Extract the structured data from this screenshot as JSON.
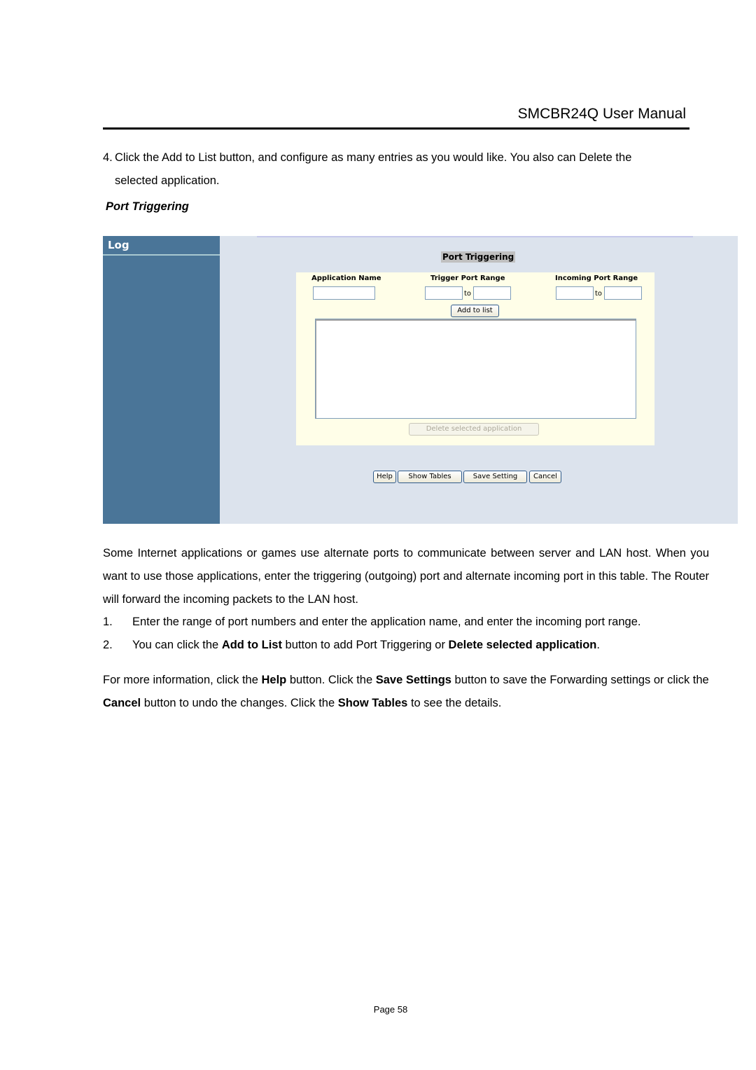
{
  "header": {
    "title": "SMCBR24Q User Manual"
  },
  "step4": {
    "number": "4.",
    "line1": "Click the Add to List button, and configure as many entries as you would like. You also can Delete the",
    "line2": "selected application."
  },
  "section_heading": "Port Triggering",
  "screenshot": {
    "sidebar": {
      "title": "Log"
    },
    "panel_title": "Port Triggering",
    "columns": {
      "application_name": "Application Name",
      "trigger_port_range": "Trigger Port Range",
      "incoming_port_range": "Incoming Port Range"
    },
    "fields": {
      "application_name": "",
      "trigger_from": "",
      "trigger_to": "",
      "incoming_from": "",
      "incoming_to": ""
    },
    "to_label": "to",
    "add_button": "Add to list",
    "application_list": [],
    "delete_button": "Delete selected application",
    "bottom_buttons": {
      "help": "Help",
      "show_tables": "Show Tables",
      "save_setting": "Save Setting",
      "cancel": "Cancel"
    },
    "colors": {
      "sidebar": "#4a7598",
      "background": "#dce3ed",
      "form_panel": "#fffee8"
    }
  },
  "body": {
    "paragraph1": "Some Internet applications or games use alternate ports to communicate between server and LAN host. When you want to use those applications, enter the triggering (outgoing) port and alternate incoming port in this table. The Router will forward the incoming packets to the LAN host.",
    "list": [
      {
        "number": "1.",
        "text": "Enter the range of port numbers and enter the application name, and enter the incoming port range."
      },
      {
        "number": "2.",
        "parts": [
          "You can click the ",
          "Add to List",
          " button to add Port Triggering or ",
          "Delete selected application",
          "."
        ]
      }
    ],
    "paragraph2_parts": [
      "For more information, click the ",
      "Help",
      " button. Click the ",
      "Save Settings",
      " button to save the Forwarding settings or click the ",
      "Cancel",
      " button to undo the changes. Click the ",
      "Show Tables",
      " to see the details."
    ]
  },
  "footer": {
    "page": "Page 58"
  }
}
